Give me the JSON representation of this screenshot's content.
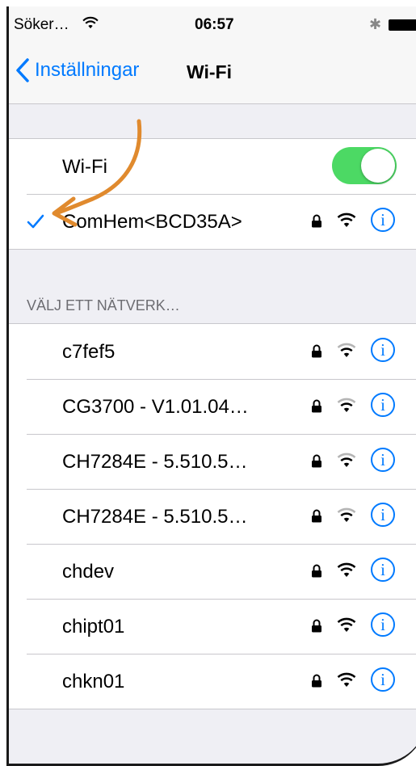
{
  "status_bar": {
    "carrier": "Söker…",
    "time": "06:57",
    "bluetooth_icon": "✱"
  },
  "nav": {
    "back_label": "Inställningar",
    "title": "Wi-Fi"
  },
  "wifi_toggle": {
    "label": "Wi-Fi",
    "on": true
  },
  "connected_network": {
    "name": "ComHem<BCD35A>",
    "secured": true,
    "signal": "strong"
  },
  "section_header": "VÄLJ ETT NÄTVERK…",
  "networks": [
    {
      "name": "c7fef5",
      "secured": true,
      "signal": "weak"
    },
    {
      "name": "CG3700 - V1.01.04…",
      "secured": true,
      "signal": "weak"
    },
    {
      "name": "CH7284E - 5.510.5…",
      "secured": true,
      "signal": "weak"
    },
    {
      "name": "CH7284E - 5.510.5…",
      "secured": true,
      "signal": "weak"
    },
    {
      "name": "chdev",
      "secured": true,
      "signal": "strong"
    },
    {
      "name": "chipt01",
      "secured": true,
      "signal": "strong"
    },
    {
      "name": "chkn01",
      "secured": true,
      "signal": "strong"
    }
  ],
  "colors": {
    "accent": "#007aff",
    "toggle_on": "#4cd964",
    "annotation_arrow": "#e08a2e",
    "background": "#efeff4"
  },
  "info_glyph": "i"
}
